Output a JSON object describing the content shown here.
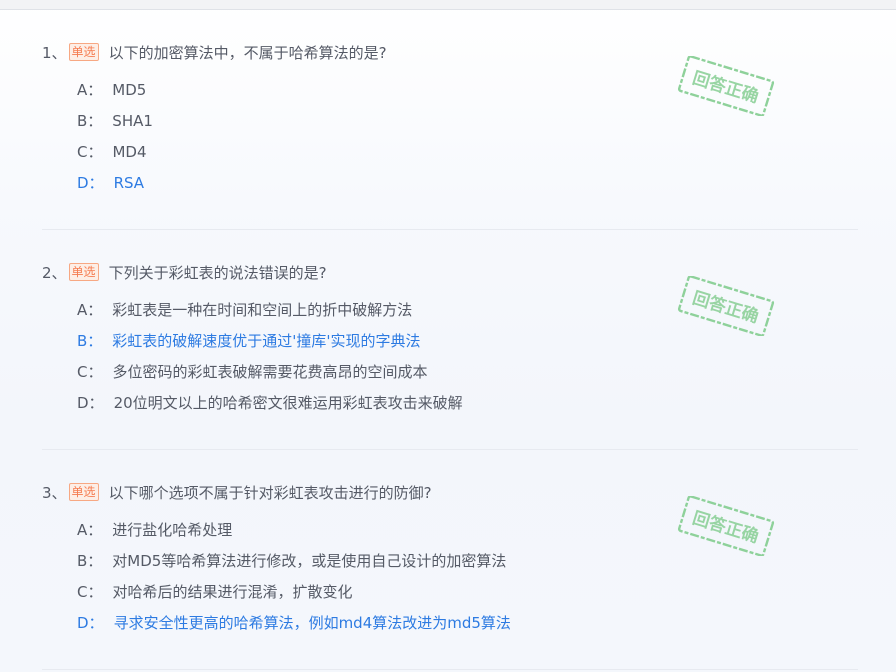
{
  "questions": [
    {
      "number": "1、",
      "type_label": "单选",
      "text": "以下的加密算法中，不属于哈希算法的是?",
      "options": [
        {
          "letter": "A：",
          "text": "MD5",
          "correct": false
        },
        {
          "letter": "B：",
          "text": "SHA1",
          "correct": false
        },
        {
          "letter": "C：",
          "text": "MD4",
          "correct": false
        },
        {
          "letter": "D：",
          "text": "RSA",
          "correct": true
        }
      ],
      "stamp_text": "回答正确"
    },
    {
      "number": "2、",
      "type_label": "单选",
      "text": "下列关于彩虹表的说法错误的是?",
      "options": [
        {
          "letter": "A：",
          "text": "彩虹表是一种在时间和空间上的折中破解方法",
          "correct": false
        },
        {
          "letter": "B：",
          "text": "彩虹表的破解速度优于通过'撞库'实现的字典法",
          "correct": true
        },
        {
          "letter": "C：",
          "text": "多位密码的彩虹表破解需要花费高昂的空间成本",
          "correct": false
        },
        {
          "letter": "D：",
          "text": "20位明文以上的哈希密文很难运用彩虹表攻击来破解",
          "correct": false
        }
      ],
      "stamp_text": "回答正确"
    },
    {
      "number": "3、",
      "type_label": "单选",
      "text": "以下哪个选项不属于针对彩虹表攻击进行的防御?",
      "options": [
        {
          "letter": "A：",
          "text": "进行盐化哈希处理",
          "correct": false
        },
        {
          "letter": "B：",
          "text": "对MD5等哈希算法进行修改，或是使用自己设计的加密算法",
          "correct": false
        },
        {
          "letter": "C：",
          "text": "对哈希后的结果进行混淆，扩散变化",
          "correct": false
        },
        {
          "letter": "D：",
          "text": "寻求安全性更高的哈希算法，例如md4算法改进为md5算法",
          "correct": true
        }
      ],
      "stamp_text": "回答正确"
    }
  ],
  "colors": {
    "correct": "#2d7be2",
    "text": "#555a66",
    "badge": "#f57b4f",
    "stamp": "#8ed19a"
  }
}
